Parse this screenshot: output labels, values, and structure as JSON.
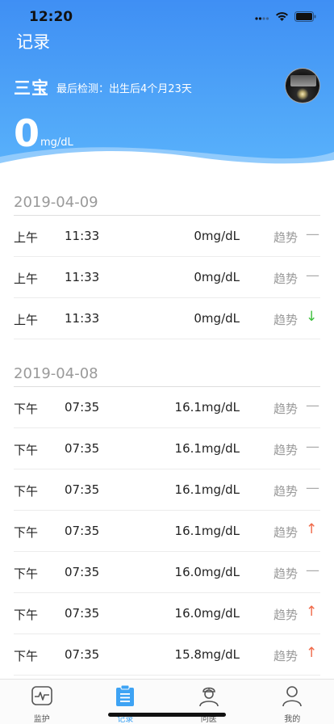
{
  "status_bar": {
    "time": "12:20"
  },
  "header": {
    "nav_title": "记录",
    "name": "三宝",
    "last_check_label": "最后检测：",
    "last_check_value": "出生后4个月23天",
    "current_value": "0",
    "current_unit": "mg/dL"
  },
  "groups": [
    {
      "date": "2019-04-09",
      "rows": [
        {
          "ampm": "上午",
          "time": "11:33",
          "value": "0mg/dL",
          "trend_label": "趋势",
          "trend": "flat",
          "trend_glyph": "—"
        },
        {
          "ampm": "上午",
          "time": "11:33",
          "value": "0mg/dL",
          "trend_label": "趋势",
          "trend": "flat",
          "trend_glyph": "—"
        },
        {
          "ampm": "上午",
          "time": "11:33",
          "value": "0mg/dL",
          "trend_label": "趋势",
          "trend": "down",
          "trend_glyph": "↓"
        }
      ]
    },
    {
      "date": "2019-04-08",
      "rows": [
        {
          "ampm": "下午",
          "time": "07:35",
          "value": "16.1mg/dL",
          "trend_label": "趋势",
          "trend": "flat",
          "trend_glyph": "—"
        },
        {
          "ampm": "下午",
          "time": "07:35",
          "value": "16.1mg/dL",
          "trend_label": "趋势",
          "trend": "flat",
          "trend_glyph": "—"
        },
        {
          "ampm": "下午",
          "time": "07:35",
          "value": "16.1mg/dL",
          "trend_label": "趋势",
          "trend": "flat",
          "trend_glyph": "—"
        },
        {
          "ampm": "下午",
          "time": "07:35",
          "value": "16.1mg/dL",
          "trend_label": "趋势",
          "trend": "up",
          "trend_glyph": "↑"
        },
        {
          "ampm": "下午",
          "time": "07:35",
          "value": "16.0mg/dL",
          "trend_label": "趋势",
          "trend": "flat",
          "trend_glyph": "—"
        },
        {
          "ampm": "下午",
          "time": "07:35",
          "value": "16.0mg/dL",
          "trend_label": "趋势",
          "trend": "up",
          "trend_glyph": "↑"
        },
        {
          "ampm": "下午",
          "time": "07:35",
          "value": "15.8mg/dL",
          "trend_label": "趋势",
          "trend": "up",
          "trend_glyph": "↑"
        }
      ]
    }
  ],
  "tabbar": {
    "tabs": [
      {
        "label": "监护",
        "icon": "monitor-icon",
        "active": false
      },
      {
        "label": "记录",
        "icon": "clipboard-icon",
        "active": true
      },
      {
        "label": "问医",
        "icon": "doctor-icon",
        "active": false
      },
      {
        "label": "我的",
        "icon": "profile-icon",
        "active": false
      }
    ]
  },
  "colors": {
    "header_top": "#3f8ff4",
    "header_bottom": "#5ab3fb",
    "accent": "#3ea3f4",
    "trend_up": "#f06a4a",
    "trend_down": "#3cbf3c",
    "trend_flat": "#aaaaaa"
  }
}
